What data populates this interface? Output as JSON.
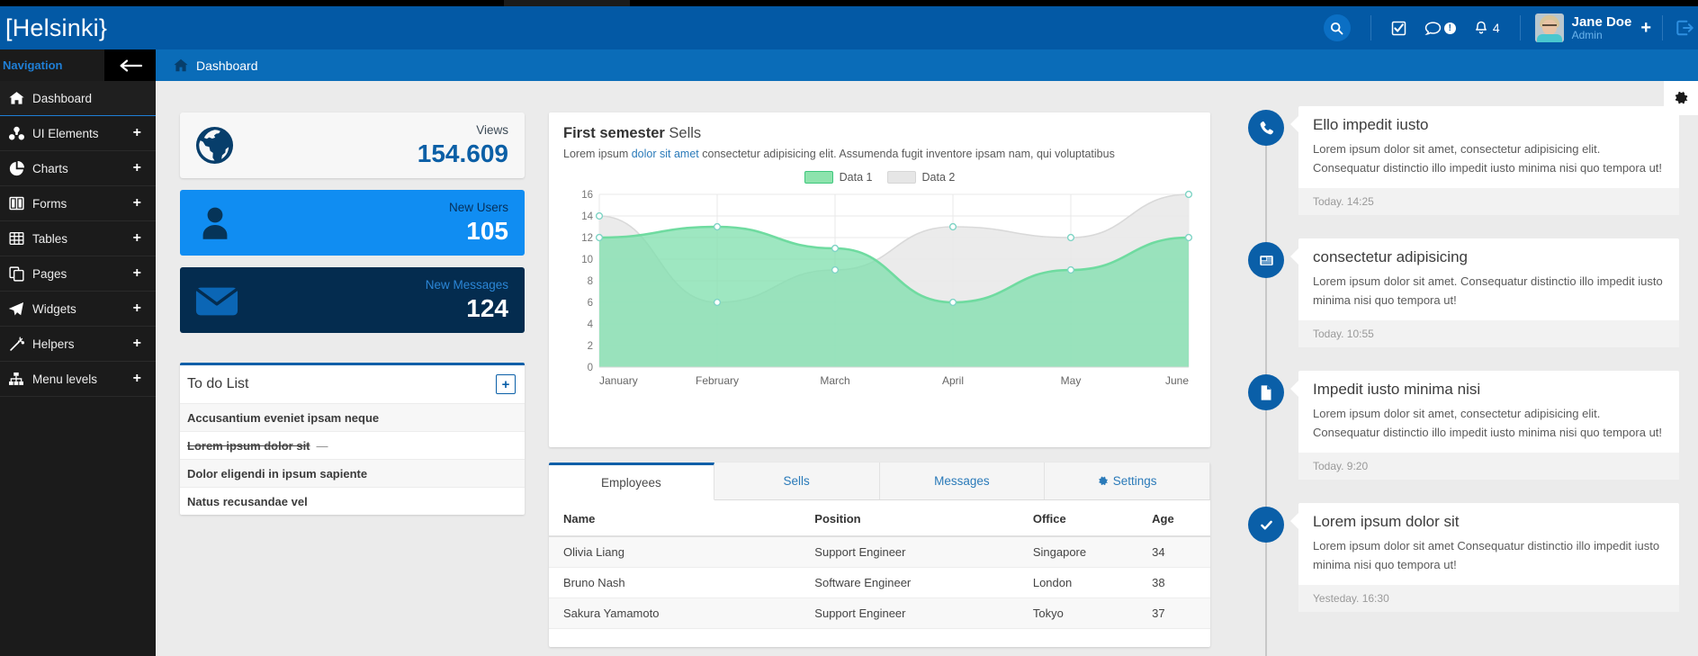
{
  "brand": {
    "name": "[Helsinki}"
  },
  "header": {
    "search_icon": "search-icon",
    "tasks_icon": "checkbox-icon",
    "messages_icon": "chat-icon",
    "messages_badge": "!",
    "bell_icon": "bell-icon",
    "bell_count": "4",
    "user_name": "Jane Doe",
    "user_role": "Admin",
    "add_label": "+",
    "logout_icon": "logout-icon"
  },
  "sidebar": {
    "title": "Navigation",
    "collapse_icon": "arrow-left-icon",
    "items": [
      {
        "label": "Dashboard",
        "icon": "home-icon",
        "expand": "",
        "active": true
      },
      {
        "label": "UI Elements",
        "icon": "cubes-icon",
        "expand": "+",
        "active": false
      },
      {
        "label": "Charts",
        "icon": "pie-chart-icon",
        "expand": "+",
        "active": false
      },
      {
        "label": "Forms",
        "icon": "columns-icon",
        "expand": "+",
        "active": false
      },
      {
        "label": "Tables",
        "icon": "table-icon",
        "expand": "+",
        "active": false
      },
      {
        "label": "Pages",
        "icon": "copy-icon",
        "expand": "+",
        "active": false
      },
      {
        "label": "Widgets",
        "icon": "paper-plane-icon",
        "expand": "+",
        "active": false
      },
      {
        "label": "Helpers",
        "icon": "magic-wand-icon",
        "expand": "+",
        "active": false
      },
      {
        "label": "Menu levels",
        "icon": "sitemap-icon",
        "expand": "+",
        "active": false
      }
    ]
  },
  "breadcrumb": {
    "home_icon": "home-icon",
    "label": "Dashboard"
  },
  "settings_tab": {
    "icon": "gear-icon"
  },
  "stats": [
    {
      "label": "Views",
      "value": "154.609",
      "icon": "globe-icon",
      "style": "views"
    },
    {
      "label": "New Users",
      "value": "105",
      "icon": "user-icon",
      "style": "users"
    },
    {
      "label": "New Messages",
      "value": "124",
      "icon": "envelope-icon",
      "style": "msgs"
    }
  ],
  "todo": {
    "title": "To do List",
    "add_label": "+",
    "items": [
      {
        "text": "Accusantium eveniet ipsam neque",
        "done": false,
        "suffix": ""
      },
      {
        "text": "Lorem ipsum dolor sit",
        "done": true,
        "suffix": "—"
      },
      {
        "text": "Dolor eligendi in ipsum sapiente",
        "done": false,
        "suffix": ""
      },
      {
        "text": "Natus recusandae vel",
        "done": false,
        "suffix": ""
      }
    ]
  },
  "chart_card": {
    "title_strong": "First semester",
    "title_rest": " Sells",
    "sub_pre": "Lorem ipsum ",
    "sub_link": "dolor sit amet",
    "sub_post": " consectetur adipisicing elit. Assumenda fugit inventore ipsam nam, qui voluptatibus"
  },
  "chart_data": {
    "type": "area",
    "title": "First semester Sells",
    "categories": [
      "January",
      "February",
      "March",
      "April",
      "May",
      "June"
    ],
    "series": [
      {
        "name": "Data 1",
        "values": [
          12,
          13,
          11,
          6,
          9,
          12
        ],
        "color": "#6fdba0",
        "fill": "#7edfac"
      },
      {
        "name": "Data 2",
        "values": [
          14,
          6,
          9,
          13,
          12,
          16
        ],
        "color": "#d9d9d9",
        "fill": "#e8e8e8"
      }
    ],
    "ylim": [
      0,
      16
    ],
    "yticks": [
      0,
      2,
      4,
      6,
      8,
      10,
      12,
      14,
      16
    ],
    "xlabel": "",
    "ylabel": "",
    "grid": true,
    "legend_position": "top-center",
    "point_marker": "circle"
  },
  "tabs": {
    "items": [
      {
        "label": "Employees",
        "icon": "",
        "active": true
      },
      {
        "label": "Sells",
        "icon": "",
        "active": false
      },
      {
        "label": "Messages",
        "icon": "",
        "active": false
      },
      {
        "label": "Settings",
        "icon": "gear-icon",
        "active": false
      }
    ]
  },
  "employees_table": {
    "columns": [
      "Name",
      "Position",
      "Office",
      "Age"
    ],
    "rows": [
      [
        "Olivia Liang",
        "Support Engineer",
        "Singapore",
        "34"
      ],
      [
        "Bruno Nash",
        "Software Engineer",
        "London",
        "38"
      ],
      [
        "Sakura Yamamoto",
        "Support Engineer",
        "Tokyo",
        "37"
      ]
    ]
  },
  "timeline": [
    {
      "icon": "phone-icon",
      "title": "Ello impedit iusto",
      "text": "Lorem ipsum dolor sit amet, consectetur adipisicing elit. Consequatur distinctio illo impedit iusto minima nisi quo tempora ut!",
      "time": "Today. 14:25"
    },
    {
      "icon": "news-icon",
      "title": "consectetur adipisicing",
      "text": "Lorem ipsum dolor sit amet. Consequatur distinctio illo impedit iusto minima nisi quo tempora ut!",
      "time": "Today. 10:55"
    },
    {
      "icon": "file-icon",
      "title": "Impedit iusto minima nisi",
      "text": "Lorem ipsum dolor sit amet, consectetur adipisicing elit. Consequatur distinctio illo impedit iusto minima nisi quo tempora ut!",
      "time": "Today. 9:20"
    },
    {
      "icon": "check-icon",
      "title": "Lorem ipsum dolor sit",
      "text": "Lorem ipsum dolor sit amet Consequatur distinctio illo impedit iusto minima nisi quo tempora ut!",
      "time": "Yesteday. 16:30"
    }
  ],
  "colors": {
    "header_blue": "#0359a5",
    "breadcrumb_blue": "#0a6cb8",
    "sidebar_dark": "#1b1b1b",
    "accent_blue": "#108df2",
    "deep_navy": "#042c4f",
    "chart_green": "#6fdba0",
    "chart_gray": "#d9d9d9"
  }
}
